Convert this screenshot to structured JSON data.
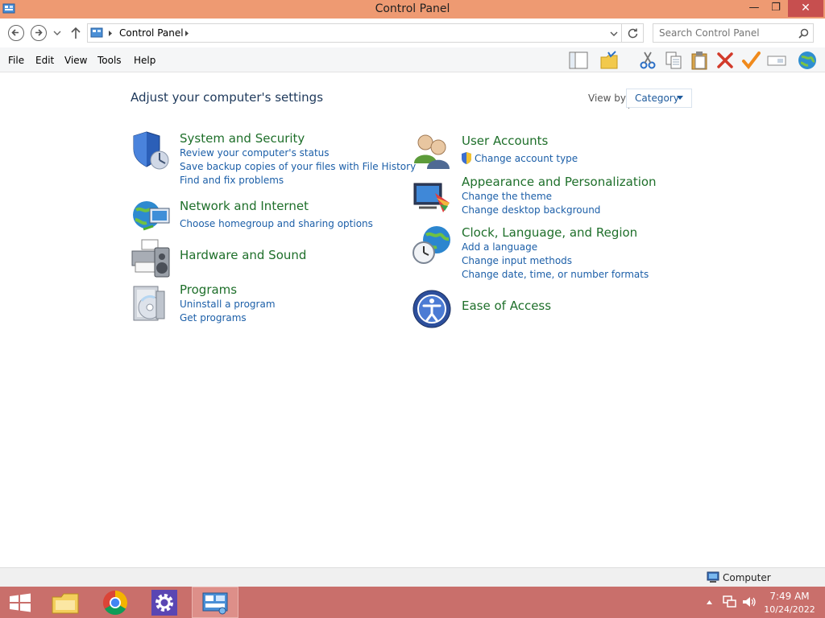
{
  "window": {
    "title": "Control Panel",
    "minimize_glyph": "—",
    "maximize_glyph": "❐",
    "close_glyph": "✕"
  },
  "address": {
    "crumb": "Control Panel",
    "search_placeholder": "Search Control Panel"
  },
  "menu": {
    "file": "File",
    "edit": "Edit",
    "view": "View",
    "tools": "Tools",
    "help": "Help"
  },
  "content": {
    "heading": "Adjust your computer's settings",
    "view_by_label": "View by:",
    "view_by_value": "Category",
    "categories": [
      {
        "title": "System and Security",
        "icon": "shield-icon",
        "links": [
          "Review your computer's status",
          "Save backup copies of your files with File History",
          "Find and fix problems"
        ]
      },
      {
        "title": "Network and Internet",
        "icon": "globe-network-icon",
        "links": [
          "Choose homegroup and sharing options"
        ]
      },
      {
        "title": "Hardware and Sound",
        "icon": "printer-speaker-icon",
        "links": []
      },
      {
        "title": "Programs",
        "icon": "programs-disc-icon",
        "links": [
          "Uninstall a program",
          "Get programs"
        ]
      },
      {
        "title": "User Accounts",
        "icon": "users-icon",
        "links": [
          "Change account type"
        ]
      },
      {
        "title": "Appearance and Personalization",
        "icon": "monitor-palette-icon",
        "links": [
          "Change the theme",
          "Change desktop background"
        ]
      },
      {
        "title": "Clock, Language, and Region",
        "icon": "clock-globe-icon",
        "links": [
          "Add a language",
          "Change input methods",
          "Change date, time, or number formats"
        ]
      },
      {
        "title": "Ease of Access",
        "icon": "ease-of-access-icon",
        "links": []
      }
    ]
  },
  "status": {
    "location": "Computer"
  },
  "taskbar": {
    "time": "7:49 AM",
    "date": "10/24/2022"
  },
  "colors": {
    "title_bar": "#ee9a72",
    "taskbar": "#c96f6b",
    "category_title": "#1e6f2a",
    "link": "#1c5fa8",
    "heading": "#1e395b"
  }
}
